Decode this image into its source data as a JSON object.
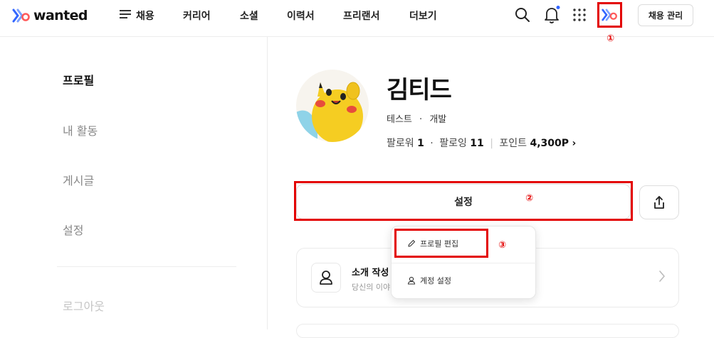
{
  "brand": {
    "name": "wanted"
  },
  "nav": {
    "items": [
      {
        "label": "채용"
      },
      {
        "label": "커리어"
      },
      {
        "label": "소셜"
      },
      {
        "label": "이력서"
      },
      {
        "label": "프리랜서"
      },
      {
        "label": "더보기"
      }
    ],
    "manage_button": "채용 관리",
    "notification_dot_color": "#3366ff"
  },
  "annotations": {
    "one": "①",
    "two": "②",
    "three": "③",
    "color": "#e30000"
  },
  "sidebar": {
    "items": [
      {
        "label": "프로필",
        "active": true
      },
      {
        "label": "내 활동"
      },
      {
        "label": "게시글"
      },
      {
        "label": "설정"
      }
    ],
    "logout": "로그아웃"
  },
  "profile": {
    "name": "김티드",
    "job_a": "테스트",
    "job_sep": "·",
    "job_b": "개발",
    "followers_label": "팔로워",
    "followers": "1",
    "following_label": "팔로잉",
    "following": "11",
    "points_label": "포인트",
    "points": "4,300P",
    "points_chevron": "›"
  },
  "actions": {
    "settings_label": "설정"
  },
  "dropdown": {
    "edit_profile": "프로필 편집",
    "account_settings": "계정 설정"
  },
  "intro_card": {
    "title": "소개 작성",
    "subtitle": "당신의 이야"
  }
}
